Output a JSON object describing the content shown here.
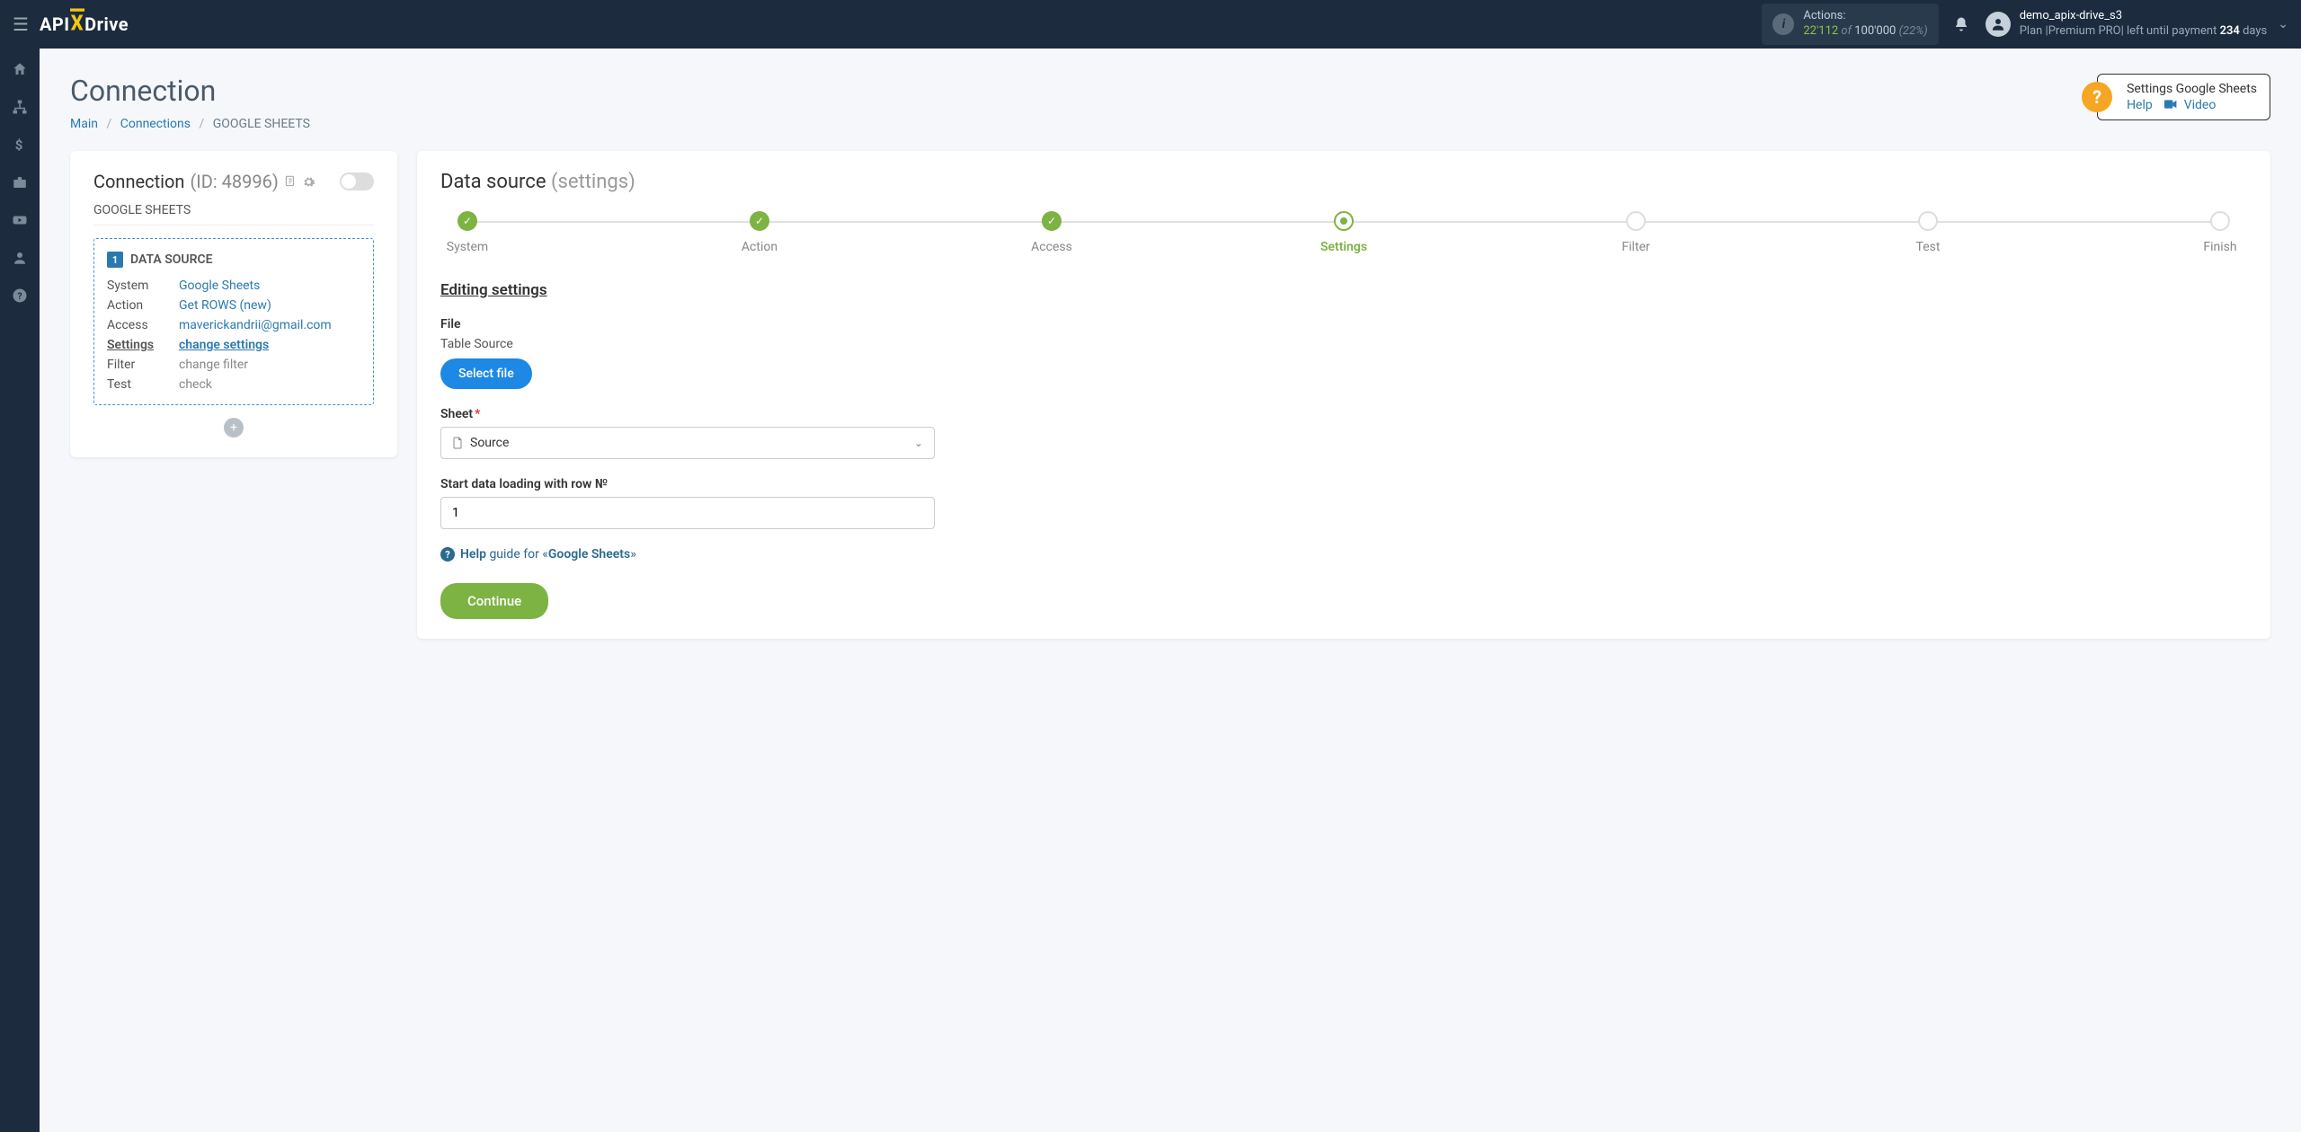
{
  "topbar": {
    "logo_pre": "API",
    "logo_post": "Drive",
    "actions_label": "Actions:",
    "actions_used": "22'112",
    "actions_of": "of",
    "actions_total": "100'000",
    "actions_pct": "(22%)",
    "user_name": "demo_apix-drive_s3",
    "user_plan_pre": "Plan |Premium PRO| left until payment ",
    "user_plan_days": "234",
    "user_plan_post": " days"
  },
  "page": {
    "title": "Connection",
    "bc_main": "Main",
    "bc_connections": "Connections",
    "bc_current": "GOOGLE SHEETS"
  },
  "helpbox": {
    "title": "Settings Google Sheets",
    "help": "Help",
    "video": "Video"
  },
  "left": {
    "heading": "Connection",
    "id_text": "(ID: 48996)",
    "subtitle": "GOOGLE SHEETS",
    "ds_num": "1",
    "ds_title": "DATA SOURCE",
    "rows": {
      "system_k": "System",
      "system_v": "Google Sheets",
      "action_k": "Action",
      "action_v": "Get ROWS (new)",
      "access_k": "Access",
      "access_v": "maverickandrii@gmail.com",
      "settings_k": "Settings",
      "settings_v": "change settings",
      "filter_k": "Filter",
      "filter_v": "change filter",
      "test_k": "Test",
      "test_v": "check"
    }
  },
  "right": {
    "title": "Data source ",
    "title_sub": "(settings)",
    "steps": [
      "System",
      "Action",
      "Access",
      "Settings",
      "Filter",
      "Test",
      "Finish"
    ],
    "section": "Editing settings",
    "file_label": "File",
    "file_value": "Table Source",
    "select_file_btn": "Select file",
    "sheet_label": "Sheet",
    "sheet_value": "Source",
    "row_label": "Start data loading with row №",
    "row_value": "1",
    "help_pre": "Help",
    "help_mid": " guide for «",
    "help_link": "Google Sheets",
    "help_post": "»",
    "continue": "Continue"
  }
}
